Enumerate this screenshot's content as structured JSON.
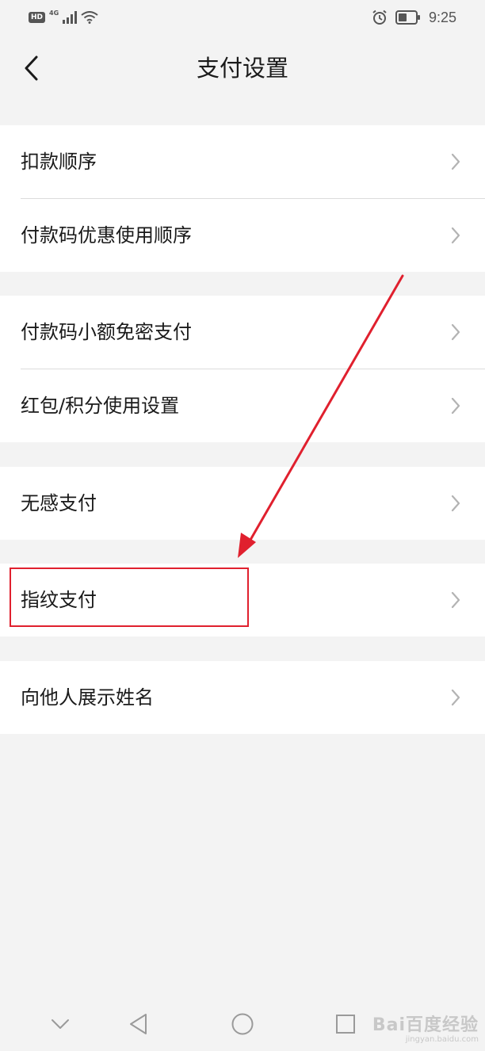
{
  "status_bar": {
    "hd": "HD",
    "network": "4G",
    "time": "9:25",
    "icons": [
      "signal-icon",
      "wifi-icon",
      "alarm-icon",
      "battery-icon"
    ]
  },
  "header": {
    "title": "支付设置",
    "back_icon": "chevron-left-icon"
  },
  "groups": [
    {
      "items": [
        {
          "label": "扣款顺序"
        },
        {
          "label": "付款码优惠使用顺序"
        }
      ]
    },
    {
      "items": [
        {
          "label": "付款码小额免密支付"
        },
        {
          "label": "红包/积分使用设置"
        }
      ]
    },
    {
      "items": [
        {
          "label": "无感支付"
        }
      ]
    },
    {
      "items": [
        {
          "label": "指纹支付"
        }
      ]
    },
    {
      "items": [
        {
          "label": "向他人展示姓名"
        }
      ]
    }
  ],
  "annotation": {
    "highlighted_item": "指纹支付",
    "color": "#e0202e"
  },
  "bottom_nav": {
    "keys": [
      "chevron-down-icon",
      "back-triangle-icon",
      "home-circle-icon",
      "recents-square-icon"
    ]
  },
  "watermark": {
    "brand": "Bai百度经验",
    "url": "jingyan.baidu.com"
  },
  "colors": {
    "background": "#f3f3f3",
    "card": "#ffffff",
    "divider": "#dcdcdc",
    "chevron": "#b3b3b3",
    "accent_red": "#e0202e"
  }
}
